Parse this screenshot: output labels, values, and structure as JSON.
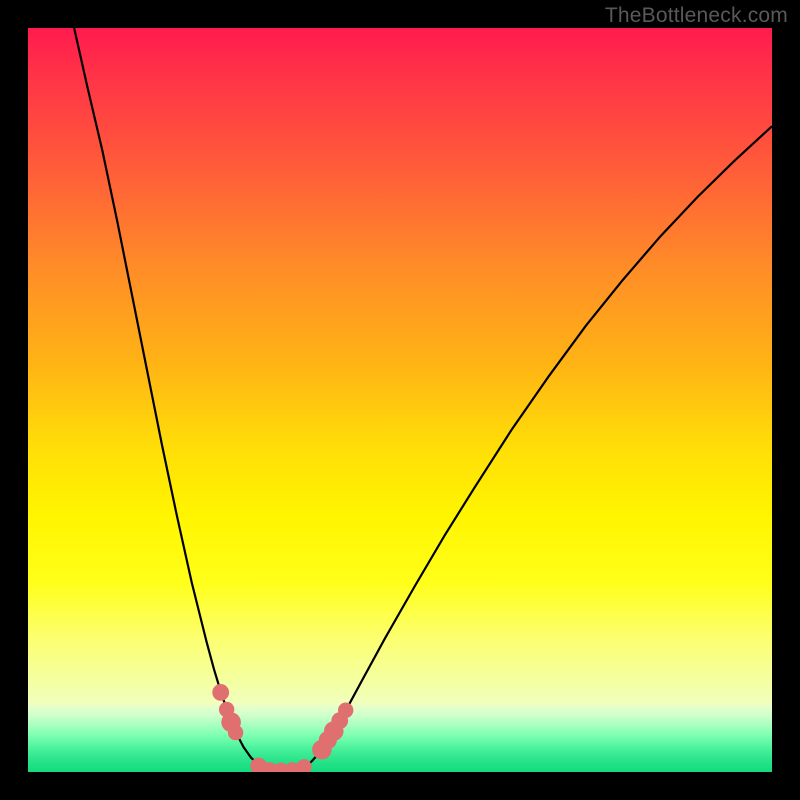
{
  "watermark": "TheBottleneck.com",
  "colors": {
    "frame": "#000000",
    "curve": "#000000",
    "markers": "#e07070",
    "gradient_top": "#ff1a4e",
    "gradient_mid": "#fff500",
    "gradient_bottom": "#14da7f"
  },
  "chart_data": {
    "type": "line",
    "title": "",
    "xlabel": "",
    "ylabel": "",
    "xlim": [
      0,
      100
    ],
    "ylim": [
      0,
      100
    ],
    "curve": [
      {
        "x": 6.2,
        "y": 100.0
      },
      {
        "x": 8.0,
        "y": 92.0
      },
      {
        "x": 10.0,
        "y": 83.5
      },
      {
        "x": 12.0,
        "y": 74.0
      },
      {
        "x": 14.0,
        "y": 64.0
      },
      {
        "x": 16.0,
        "y": 54.0
      },
      {
        "x": 18.0,
        "y": 44.0
      },
      {
        "x": 20.0,
        "y": 34.5
      },
      {
        "x": 22.0,
        "y": 25.5
      },
      {
        "x": 24.0,
        "y": 17.5
      },
      {
        "x": 25.0,
        "y": 13.8
      },
      {
        "x": 26.0,
        "y": 10.5
      },
      {
        "x": 27.0,
        "y": 7.6
      },
      {
        "x": 28.0,
        "y": 5.2
      },
      {
        "x": 29.0,
        "y": 3.3
      },
      {
        "x": 30.0,
        "y": 1.9
      },
      {
        "x": 31.0,
        "y": 1.0
      },
      {
        "x": 32.0,
        "y": 0.45
      },
      {
        "x": 33.0,
        "y": 0.2
      },
      {
        "x": 34.0,
        "y": 0.2
      },
      {
        "x": 35.0,
        "y": 0.2
      },
      {
        "x": 36.0,
        "y": 0.3
      },
      {
        "x": 37.0,
        "y": 0.6
      },
      {
        "x": 38.0,
        "y": 1.3
      },
      {
        "x": 39.0,
        "y": 2.4
      },
      {
        "x": 40.0,
        "y": 3.8
      },
      {
        "x": 41.5,
        "y": 6.2
      },
      {
        "x": 43.0,
        "y": 8.8
      },
      {
        "x": 45.0,
        "y": 12.5
      },
      {
        "x": 48.0,
        "y": 18.0
      },
      {
        "x": 52.0,
        "y": 25.0
      },
      {
        "x": 56.0,
        "y": 31.8
      },
      {
        "x": 60.0,
        "y": 38.2
      },
      {
        "x": 65.0,
        "y": 46.0
      },
      {
        "x": 70.0,
        "y": 53.2
      },
      {
        "x": 75.0,
        "y": 60.0
      },
      {
        "x": 80.0,
        "y": 66.2
      },
      {
        "x": 85.0,
        "y": 72.0
      },
      {
        "x": 90.0,
        "y": 77.3
      },
      {
        "x": 95.0,
        "y": 82.2
      },
      {
        "x": 100.0,
        "y": 86.8
      }
    ],
    "markers": [
      {
        "x": 25.9,
        "y": 10.7,
        "r": 1.2
      },
      {
        "x": 26.7,
        "y": 8.4,
        "r": 1.1
      },
      {
        "x": 27.3,
        "y": 6.7,
        "r": 1.4
      },
      {
        "x": 27.9,
        "y": 5.3,
        "r": 1.1
      },
      {
        "x": 31.0,
        "y": 0.8,
        "r": 1.2
      },
      {
        "x": 32.5,
        "y": 0.3,
        "r": 1.1
      },
      {
        "x": 34.0,
        "y": 0.25,
        "r": 1.1
      },
      {
        "x": 35.5,
        "y": 0.3,
        "r": 1.1
      },
      {
        "x": 37.1,
        "y": 0.7,
        "r": 1.1
      },
      {
        "x": 39.5,
        "y": 3.0,
        "r": 1.4
      },
      {
        "x": 40.3,
        "y": 4.3,
        "r": 1.3
      },
      {
        "x": 41.1,
        "y": 5.5,
        "r": 1.4
      },
      {
        "x": 41.9,
        "y": 6.9,
        "r": 1.2
      },
      {
        "x": 42.7,
        "y": 8.3,
        "r": 1.1
      }
    ]
  }
}
